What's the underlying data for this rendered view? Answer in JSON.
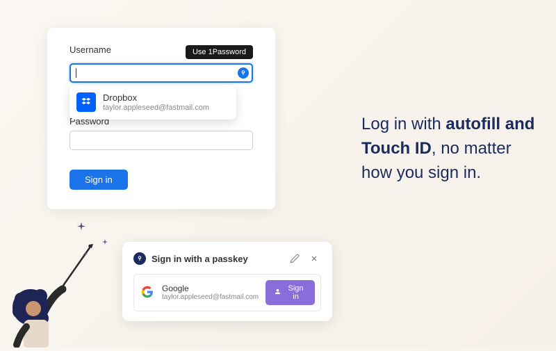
{
  "login": {
    "username_label": "Username",
    "password_label": "Password",
    "tooltip": "Use 1Password",
    "signin_button": "Sign in",
    "suggestion": {
      "title": "Dropbox",
      "subtitle": "taylor.appleseed@fastmail.com"
    }
  },
  "passkey": {
    "header": "Sign in with a passkey",
    "provider": "Google",
    "email": "taylor.appleseed@fastmail.com",
    "button": "Sign in"
  },
  "headline": {
    "part1": "Log in with ",
    "bold": "autofill and Touch ID",
    "part2": ", no matter how you sign in."
  },
  "icons": {
    "onepassword": "1",
    "dropbox": "dropbox-icon",
    "google": "google-icon",
    "edit": "edit-icon",
    "close": "close-icon",
    "person": "person-icon"
  }
}
